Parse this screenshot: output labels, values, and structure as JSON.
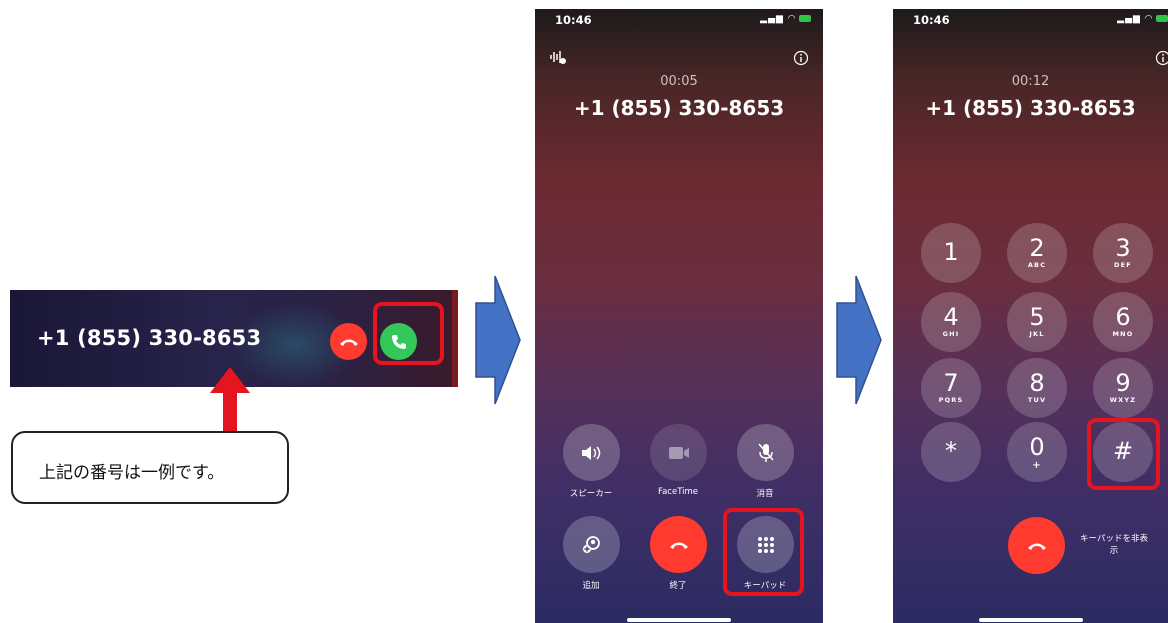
{
  "banner": {
    "phone_number": "+1 (855) 330-8653"
  },
  "callout": {
    "text": "上記の番号は一例です。"
  },
  "phone1": {
    "time": "10:46",
    "timer": "00:05",
    "number": "+1 (855) 330-8653",
    "controls": {
      "speaker": "スピーカー",
      "facetime": "FaceTime",
      "mute": "消音",
      "add": "追加",
      "end": "終了",
      "keypad": "キーパッド"
    }
  },
  "phone2": {
    "time": "10:46",
    "timer": "00:12",
    "number": "+1 (855) 330-8653",
    "keys": [
      {
        "digit": "1",
        "letters": ""
      },
      {
        "digit": "2",
        "letters": "ABC"
      },
      {
        "digit": "3",
        "letters": "DEF"
      },
      {
        "digit": "4",
        "letters": "GHI"
      },
      {
        "digit": "5",
        "letters": "JKL"
      },
      {
        "digit": "6",
        "letters": "MNO"
      },
      {
        "digit": "7",
        "letters": "PQRS"
      },
      {
        "digit": "8",
        "letters": "TUV"
      },
      {
        "digit": "9",
        "letters": "WXYZ"
      },
      {
        "digit": "*",
        "letters": ""
      },
      {
        "digit": "0",
        "letters": "+"
      },
      {
        "digit": "#",
        "letters": ""
      }
    ],
    "hide_keypad": "キーパッドを非表示"
  },
  "colors": {
    "accept_green": "#34c759",
    "decline_red": "#ff3b30",
    "highlight_red": "#e4151f",
    "arrow_blue": "#4472c4"
  },
  "icons": {
    "accept": "phone-accept-icon",
    "decline": "phone-decline-icon",
    "speaker": "speaker-icon",
    "facetime": "video-camera-icon",
    "mute": "mic-slash-icon",
    "add": "add-call-icon",
    "keypad": "keypad-grid-icon",
    "info": "info-icon",
    "waveform": "waveform-icon"
  }
}
